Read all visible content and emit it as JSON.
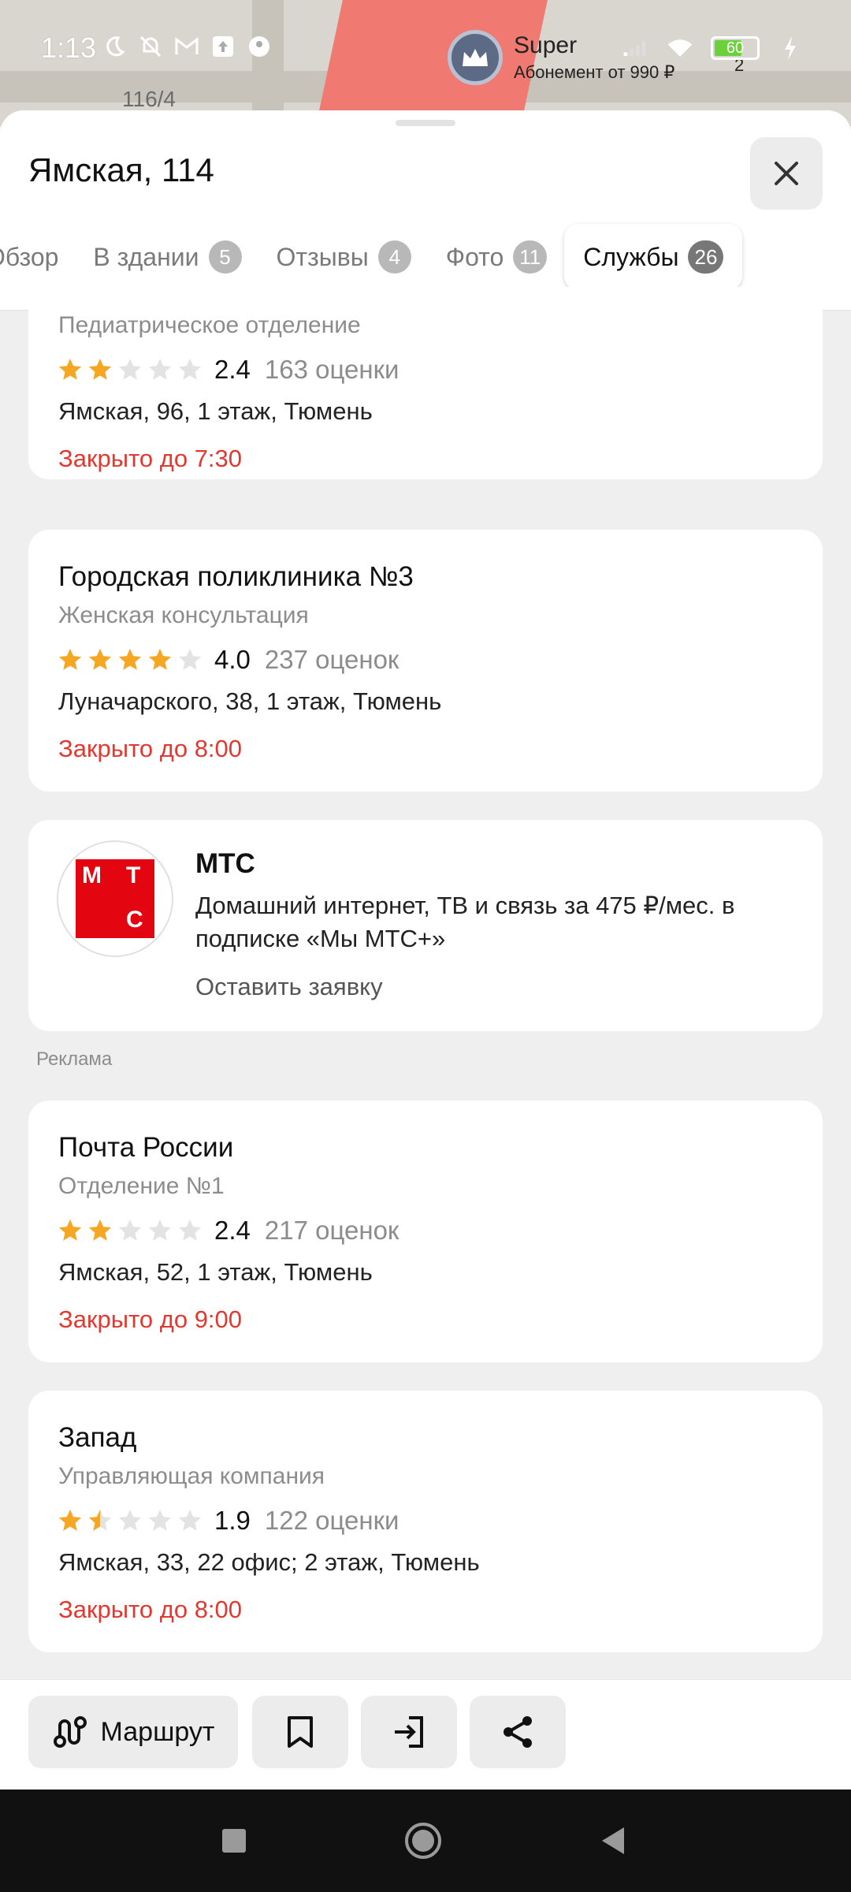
{
  "status_bar": {
    "time": "1:13",
    "battery_level": "60",
    "battery_fraction": 0.6
  },
  "map": {
    "house_number": "116/4",
    "badge_name": "Super",
    "badge_sub": "Абонемент от 990 ₽",
    "badge_count": "2"
  },
  "sheet": {
    "title": "Ямская, 114",
    "close_icon": "close-icon"
  },
  "tabs": [
    {
      "label": "Обзор",
      "count": ""
    },
    {
      "label": "В здании",
      "count": "5"
    },
    {
      "label": "Отзывы",
      "count": "4"
    },
    {
      "label": "Фото",
      "count": "11"
    },
    {
      "label": "Службы",
      "count": "26",
      "active": true
    }
  ],
  "cards": [
    {
      "name": "",
      "category": "Педиатрическое отделение",
      "rating": "2.4",
      "stars": 2,
      "reviews": "163 оценки",
      "address": "Ямская, 96, 1 этаж, Тюмень",
      "hours": "Закрыто до 7:30"
    },
    {
      "name": "Городская поликлиника №3",
      "category": "Женская консультация",
      "rating": "4.0",
      "stars": 4,
      "reviews": "237 оценок",
      "address": "Луначарского, 38, 1 этаж, Тюмень",
      "hours": "Закрыто до 8:00"
    },
    {
      "name": "Почта России",
      "category": "Отделение №1",
      "rating": "2.4",
      "stars": 2,
      "reviews": "217 оценок",
      "address": "Ямская, 52, 1 этаж, Тюмень",
      "hours": "Закрыто до 9:00"
    },
    {
      "name": "Запад",
      "category": "Управляющая компания",
      "rating": "1.9",
      "stars": 1.5,
      "reviews": "122 оценки",
      "address": "Ямская, 33, 22 офис; 2 этаж, Тюмень",
      "hours": "Закрыто до 8:00"
    }
  ],
  "ad": {
    "title": "МТС",
    "description": "Домашний интернет, ТВ и связь за 475 ₽/мес. в подписке «Мы МТС+»",
    "link": "Оставить заявку",
    "label": "Реклама",
    "logo_letters": [
      "М",
      "Т",
      "С"
    ]
  },
  "actions": {
    "route_label": "Маршрут",
    "buttons": [
      "route-icon",
      "bookmark-icon",
      "enter-icon",
      "share-icon"
    ]
  },
  "colors": {
    "closed": "#e2382f",
    "star_on": "#f5a623",
    "star_off": "#e3e3e3",
    "mts_red": "#e30611"
  }
}
